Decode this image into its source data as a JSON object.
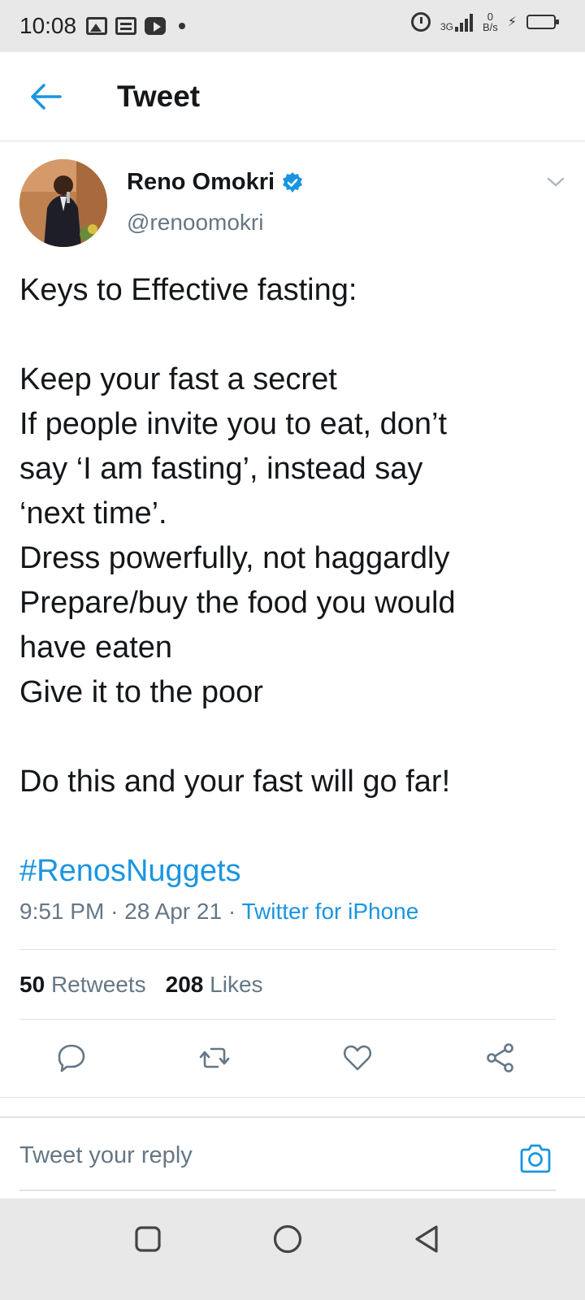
{
  "status_bar": {
    "time": "10:08",
    "network_type": "3G",
    "net_speed_value": "0",
    "net_speed_unit": "B/s"
  },
  "header": {
    "title": "Tweet"
  },
  "tweet": {
    "author_name": "Reno Omokri",
    "author_handle": "@renoomokri",
    "body_lines": [
      "Keys to Effective fasting:",
      "",
      "Keep your fast a secret",
      "If people invite you to eat, don’t",
      "say ‘I am fasting’, instead say",
      "‘next time’.",
      "Dress powerfully, not haggardly",
      "Prepare/buy the food you would",
      "have eaten",
      "Give it to the poor",
      "",
      "Do this and your fast will go far!",
      "",
      "#RenosNuggets"
    ],
    "time": "9:51 PM",
    "separator": "·",
    "date": "28 Apr 21",
    "source": "Twitter for iPhone",
    "retweet_count": "50",
    "retweet_label": "Retweets",
    "like_count": "208",
    "like_label": "Likes"
  },
  "reply": {
    "placeholder": "Tweet your reply"
  },
  "colors": {
    "accent": "#1b95e0",
    "text": "#14171a",
    "secondary_text": "#657786"
  },
  "icons": {
    "back": "arrow-left-icon",
    "verified": "verified-badge-icon",
    "more": "chevron-down-icon",
    "reply": "comment-icon",
    "retweet": "retweet-icon",
    "like": "heart-icon",
    "share": "share-icon",
    "camera": "camera-icon"
  }
}
